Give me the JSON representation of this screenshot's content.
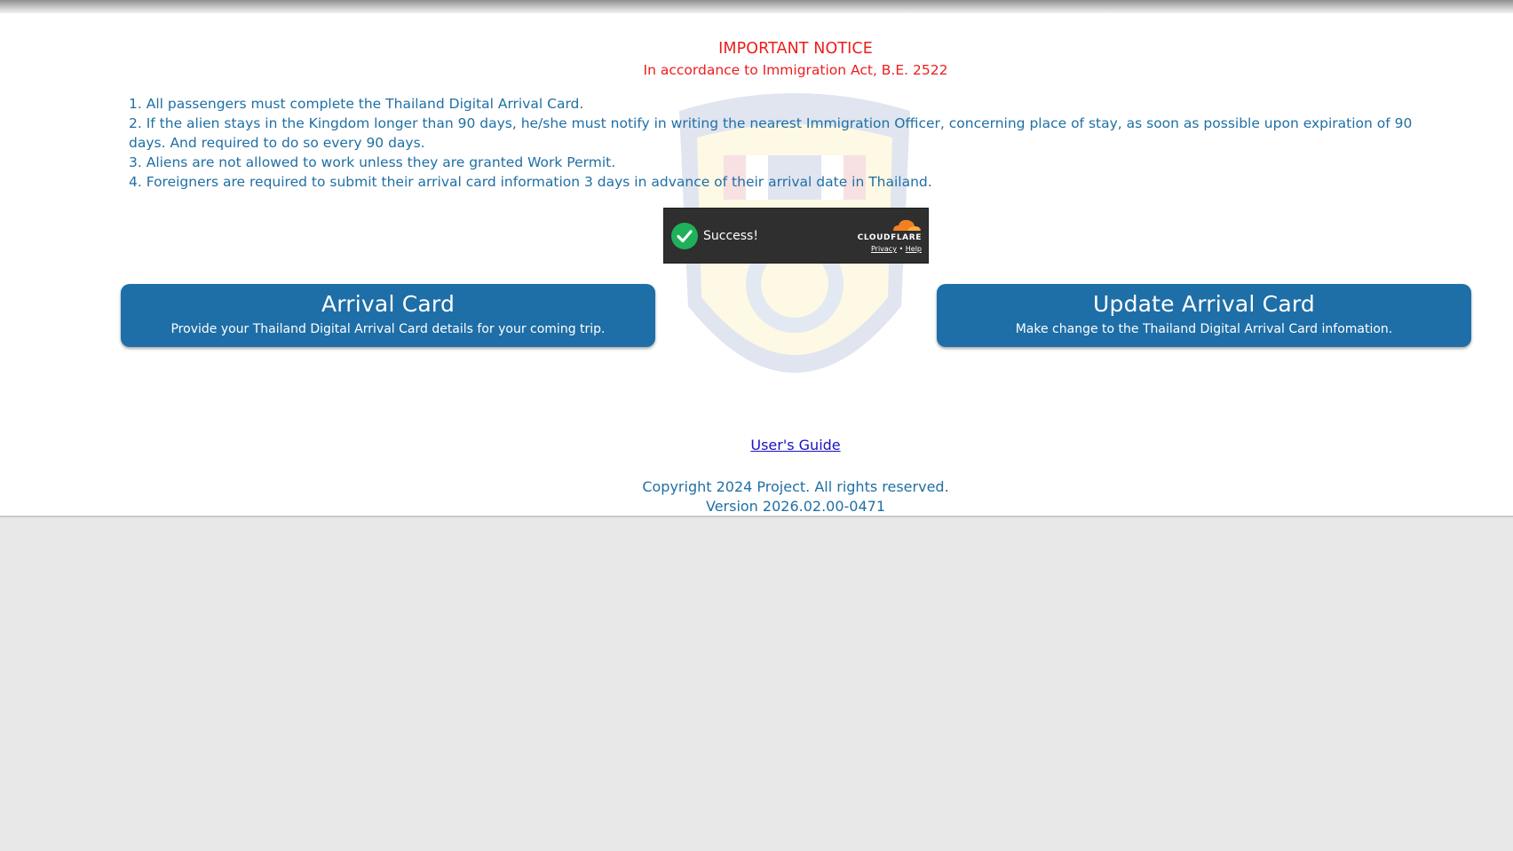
{
  "notice": {
    "title": "IMPORTANT NOTICE",
    "subtitle": "In accordance to Immigration Act, B.E. 2522",
    "items": [
      "1. All passengers must complete the Thailand Digital Arrival Card.",
      "2. If the alien stays in the Kingdom longer than 90 days, he/she must notify in writing the nearest Immigration Officer, concerning place of stay, as soon as possible upon expiration of 90 days. And required to do so every 90 days.",
      "3. Aliens are not allowed to work unless they are granted Work Permit.",
      "4. Foreigners are required to submit their arrival card information 3 days in advance of their arrival date in Thailand."
    ]
  },
  "captcha": {
    "status": "Success!",
    "brand": "CLOUDFLARE",
    "privacy_label": "Privacy",
    "separator": "•",
    "help_label": "Help",
    "check_color": "#1eb15a",
    "brand_color": "#f38020"
  },
  "buttons": {
    "arrival": {
      "title": "Arrival Card",
      "description": "Provide your Thailand Digital Arrival Card details for your coming trip."
    },
    "update": {
      "title": "Update Arrival Card",
      "description": "Make change to the Thailand Digital Arrival Card infomation."
    }
  },
  "guide_link": "User's Guide",
  "footer": {
    "copyright": "Copyright 2024 Project. All rights reserved.",
    "version": "Version 2026.02.00-0471"
  },
  "colors": {
    "notice_red": "#ee1c1c",
    "text_blue": "#1f6fa4",
    "button_blue": "#1e6ea7",
    "link_blue": "#1a10c7"
  }
}
